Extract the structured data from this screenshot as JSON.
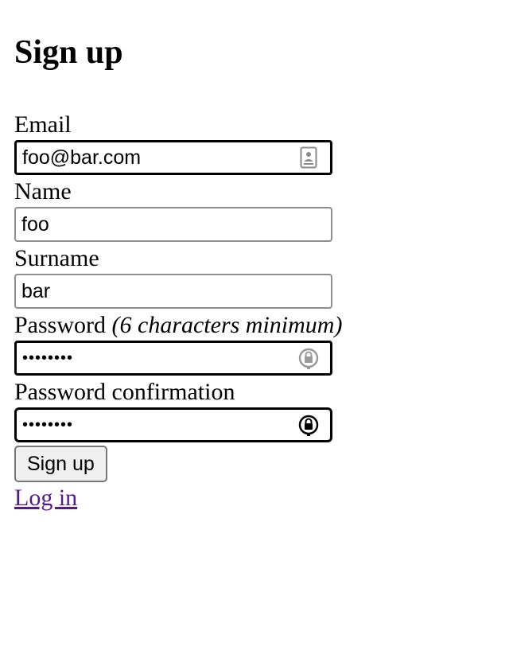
{
  "page": {
    "title": "Sign up"
  },
  "form": {
    "email": {
      "label": "Email",
      "value": "foo@bar.com"
    },
    "name": {
      "label": "Name",
      "value": "foo"
    },
    "surname": {
      "label": "Surname",
      "value": "bar"
    },
    "password": {
      "label": "Password",
      "hint": "(6 characters minimum)",
      "value": "password"
    },
    "password_confirmation": {
      "label": "Password confirmation",
      "value": "password"
    },
    "submit_label": "Sign up",
    "login_link": "Log in"
  },
  "icons": {
    "email_field_icon": "contact-card-icon",
    "password_field_icon": "key-lock-icon",
    "password_confirmation_field_icon": "key-lock-icon"
  }
}
